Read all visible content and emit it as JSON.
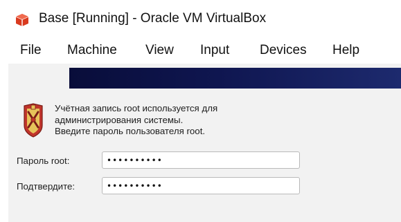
{
  "window": {
    "title": "Base [Running] - Oracle VM VirtualBox"
  },
  "menu": {
    "items": [
      {
        "label": "File"
      },
      {
        "label": "Machine"
      },
      {
        "label": "View"
      },
      {
        "label": "Input"
      },
      {
        "label": "Devices"
      },
      {
        "label": "Help"
      }
    ]
  },
  "dialog": {
    "icon": "shield-icon",
    "message_lines": [
      "Учётная запись root используется для",
      "администрирования системы.",
      "Введите пароль пользователя root."
    ],
    "password_label": "Пароль root:",
    "password_value": "••••••••••",
    "confirm_label": "Подтвердите:",
    "confirm_value": "••••••••••"
  },
  "colors": {
    "vm_background": "#f2f2f2",
    "banner": "#0f1650",
    "virtualbox_icon": "#d93a1f"
  }
}
